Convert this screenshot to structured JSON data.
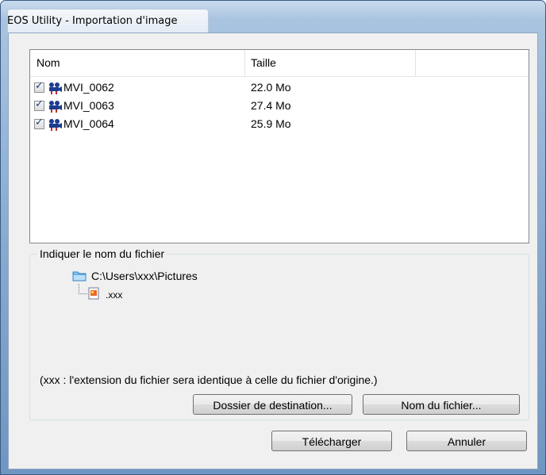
{
  "window": {
    "title": "EOS Utility - Importation d'image"
  },
  "list": {
    "columns": {
      "name": "Nom",
      "size": "Taille"
    },
    "rows": [
      {
        "name": "MVI_0062",
        "size": "22.0 Mo",
        "checked": true
      },
      {
        "name": "MVI_0063",
        "size": "27.4 Mo",
        "checked": true
      },
      {
        "name": "MVI_0064",
        "size": "25.9 Mo",
        "checked": true
      }
    ]
  },
  "filename_group": {
    "legend": "Indiquer le nom du fichier",
    "folder_path": "C:\\Users\\xxx\\Pictures",
    "file_ext": ".xxx",
    "note": "(xxx : l'extension du fichier sera identique à celle du fichier d'origine.)",
    "dest_button": "Dossier de destination...",
    "name_button": "Nom du fichier..."
  },
  "buttons": {
    "download": "Télécharger",
    "cancel": "Annuler"
  },
  "icons": {
    "row": "movie-camera-icon",
    "folder": "folder-icon",
    "file": "file-icon"
  }
}
